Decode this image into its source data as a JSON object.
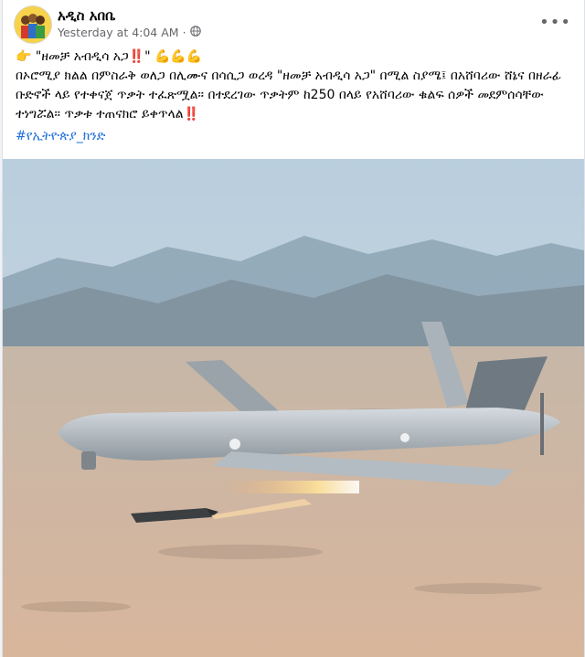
{
  "page": {
    "name": "አዲስ አበቤ"
  },
  "post": {
    "timestamp": "Yesterday at 4:04 AM",
    "separator": "·",
    "headline_prefix": "👉",
    "headline": "\"ዘመቻ አብዲሳ አጋ‼️\"",
    "headline_suffix": "💪💪💪",
    "body": "በኦሮሚያ ክልል በምስራቅ ወለጋ በሊሙና በሳሲጋ ወረዳ \"ዘመቻ አብዲሳ አጋ\" በሚል ስያሜ፤ በአሸባሪው ሸኔና በዘራፊ ቡድኖች ላይ የተቀናጀ ጥቃት ተፈጽሟል። በተደረገው ጥቃትም ከ250 በላይ የአሸባሪው ቁልፍ ሰዎች መደምሰሳቸው ተነግሯል። ጥቃቱ ተጠናክሮ ይቀጥላል‼️",
    "hashtag": "#የኢትዮጵያ_ክንድ"
  },
  "icons": {
    "privacy": "globe-icon",
    "menu": "more-options-icon"
  },
  "colors": {
    "link": "#216fdb",
    "meta": "#65676b",
    "text": "#050505"
  }
}
